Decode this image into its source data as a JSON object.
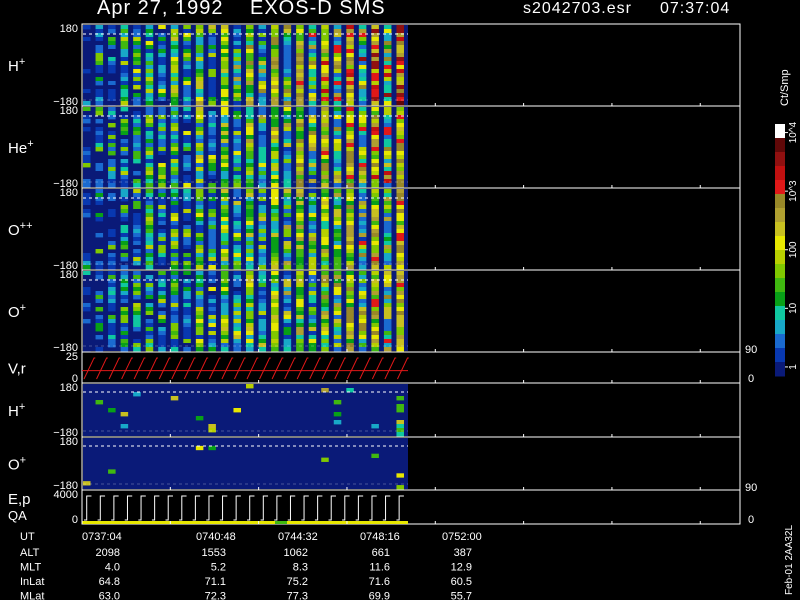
{
  "header": {
    "date": "Apr 27, 1992",
    "instrument": "EXOS-D SMS",
    "file": "s2042703.esr",
    "time": "07:37:04"
  },
  "colorbar": {
    "title": "Ct/Smp",
    "labels": [
      {
        "text": "1",
        "value": 1
      },
      {
        "text": "10",
        "value": 10
      },
      {
        "text": "100",
        "value": 100
      },
      {
        "text": "10^3",
        "value": 1000
      },
      {
        "text": "10^4",
        "value": 10000
      }
    ],
    "range": [
      0.7,
      14000
    ],
    "colors": [
      "#0a1a78",
      "#0838b0",
      "#1a6ad0",
      "#18a8c8",
      "#10c8a0",
      "#08a018",
      "#40b810",
      "#80c800",
      "#b8d000",
      "#e8e800",
      "#c8c020",
      "#b0a030",
      "#988828",
      "#e01818",
      "#c01010",
      "#901010",
      "#600808",
      "#ffffff"
    ]
  },
  "footer": {
    "id": "Feb-01 2AA32L"
  },
  "chart_data": {
    "type": "heatmap",
    "title": "",
    "panels": [
      {
        "label": "H",
        "sup": "+",
        "kind": "spectrogram",
        "ytop": "180",
        "ybot": "−180",
        "ylim": [
          -180,
          180
        ],
        "intensity": 0.62
      },
      {
        "label": "He",
        "sup": "+",
        "kind": "spectrogram",
        "ytop": "180",
        "ybot": "−180",
        "ylim": [
          -180,
          180
        ],
        "intensity": 0.55
      },
      {
        "label": "O",
        "sup": "++",
        "kind": "spectrogram",
        "ytop": "180",
        "ybot": "−180",
        "ylim": [
          -180,
          180
        ],
        "intensity": 0.5
      },
      {
        "label": "O",
        "sup": "+",
        "kind": "spectrogram",
        "ytop": "180",
        "ybot": "−180",
        "ylim": [
          -180,
          180
        ],
        "intensity": 0.5
      },
      {
        "label": "V,r",
        "sup": "",
        "kind": "sweep",
        "ytop": "25",
        "ybot": "0",
        "right_top": "90",
        "right_bot": "0",
        "ylim": [
          0,
          25
        ],
        "sweeps": 26
      },
      {
        "label": "H",
        "sup": "+",
        "kind": "sparse",
        "ytop": "180",
        "ybot": "−180",
        "ylim": [
          -180,
          180
        ],
        "intensity": 0.05
      },
      {
        "label": "O",
        "sup": "+",
        "kind": "sparse",
        "ytop": "180",
        "ybot": "−180",
        "ylim": [
          -180,
          180
        ],
        "intensity": 0.02
      },
      {
        "label": "E,p",
        "label2": "QA",
        "sup": "",
        "kind": "sweep",
        "ytop": "4000",
        "ybot": "0",
        "right_top": "90",
        "right_bot": "0",
        "ylim": [
          0,
          4000
        ],
        "sweeps": 24
      }
    ],
    "columns": 26,
    "rows_label": "UT",
    "ticks": [
      "0737:04",
      "0740:48",
      "0744:32",
      "0748:16",
      "0752:00"
    ],
    "table": [
      {
        "name": "ALT",
        "values": [
          "2098",
          "1553",
          "1062",
          "661",
          "387"
        ]
      },
      {
        "name": "MLT",
        "values": [
          "4.0",
          "5.2",
          "8.3",
          "11.6",
          "12.9"
        ]
      },
      {
        "name": "InLat",
        "values": [
          "64.8",
          "71.1",
          "75.2",
          "71.6",
          "60.5"
        ]
      },
      {
        "name": "MLat",
        "values": [
          "63.0",
          "72.3",
          "77.3",
          "69.9",
          "55.7"
        ]
      }
    ],
    "xlim": [
      "0737:04",
      "0752:00"
    ]
  }
}
